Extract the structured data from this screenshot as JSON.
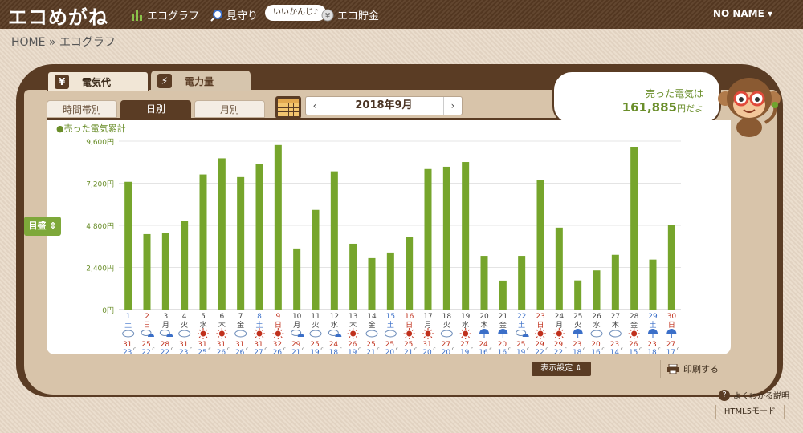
{
  "header": {
    "logo": "エコめがね",
    "nav": [
      {
        "label": "エコグラフ",
        "icon": "bar-chart-icon"
      },
      {
        "label": "見守り",
        "icon": "magnifier-icon"
      },
      {
        "label": "エコ貯金",
        "icon": "coin-icon"
      }
    ],
    "speech": "いいかんじ♪",
    "user": "NO NAME ▾"
  },
  "breadcrumb": "HOME » エコグラフ",
  "tabs": {
    "primary": [
      {
        "label": "電気代",
        "icon": "yen-icon",
        "active": true
      },
      {
        "label": "電力量",
        "icon": "lightning-icon",
        "active": false
      }
    ],
    "secondary": [
      {
        "label": "時間帯別",
        "active": false
      },
      {
        "label": "日別",
        "active": true
      },
      {
        "label": "月別",
        "active": false
      }
    ]
  },
  "month_nav": {
    "prev": "‹",
    "label": "2018年9月",
    "next": "›"
  },
  "bubble": {
    "line1": "売った電気は",
    "amount": "161,885",
    "suffix": "円だよ"
  },
  "controls": {
    "goal": "目盛 ⇕",
    "display": "表示設定 ⇕",
    "print": "印刷する",
    "help": "よくわかる説明",
    "html5": "HTML5モード"
  },
  "colors": {
    "bar": "#76a52c",
    "brown": "#5a3c24",
    "saturday": "#3b6fc8",
    "sunday": "#c0301c"
  },
  "chart_data": {
    "type": "bar",
    "legend": "●売った電気累計",
    "yticks": [
      "9,600円",
      "7,200円",
      "4,800円",
      "2,400円",
      "0円"
    ],
    "ylim": [
      0,
      9600
    ],
    "days": [
      "1",
      "2",
      "3",
      "4",
      "5",
      "6",
      "7",
      "8",
      "9",
      "10",
      "11",
      "12",
      "13",
      "14",
      "15",
      "16",
      "17",
      "18",
      "19",
      "20",
      "21",
      "22",
      "23",
      "24",
      "25",
      "26",
      "27",
      "28",
      "29",
      "30"
    ],
    "weekdays": [
      "土",
      "日",
      "月",
      "火",
      "水",
      "木",
      "金",
      "土",
      "日",
      "月",
      "火",
      "水",
      "木",
      "金",
      "土",
      "日",
      "月",
      "火",
      "水",
      "木",
      "金",
      "土",
      "日",
      "月",
      "火",
      "水",
      "木",
      "金",
      "土",
      "日"
    ],
    "values": [
      7280,
      4300,
      4380,
      5030,
      7700,
      8620,
      7550,
      8280,
      9380,
      3480,
      5680,
      7880,
      3750,
      2930,
      3250,
      4130,
      8010,
      8140,
      8410,
      3060,
      1650,
      3060,
      7370,
      4670,
      1660,
      2230,
      3120,
      9280,
      2850,
      4800
    ],
    "weather": [
      "cloud",
      "cloud-umbrella",
      "cloud-umbrella",
      "cloud",
      "sun",
      "sun",
      "cloud",
      "sun",
      "sun",
      "cloud-umbrella",
      "cloud",
      "cloud-umbrella",
      "sun",
      "cloud",
      "cloud",
      "sun",
      "sun",
      "cloud",
      "sun",
      "umbrella",
      "umbrella",
      "cloud-umbrella",
      "sun",
      "sun",
      "umbrella",
      "cloud",
      "cloud",
      "sun",
      "umbrella",
      "umbrella"
    ],
    "temp_high": [
      31,
      25,
      28,
      31,
      31,
      31,
      31,
      31,
      32,
      29,
      25,
      24,
      26,
      25,
      25,
      25,
      31,
      27,
      27,
      24,
      20,
      25,
      29,
      29,
      23,
      20,
      23,
      26,
      23,
      27
    ],
    "temp_low": [
      23,
      22,
      22,
      23,
      25,
      26,
      26,
      27,
      26,
      21,
      19,
      18,
      19,
      21,
      20,
      21,
      20,
      20,
      19,
      16,
      16,
      19,
      22,
      22,
      18,
      16,
      14,
      15,
      18,
      17
    ],
    "degree_unit": "c"
  }
}
